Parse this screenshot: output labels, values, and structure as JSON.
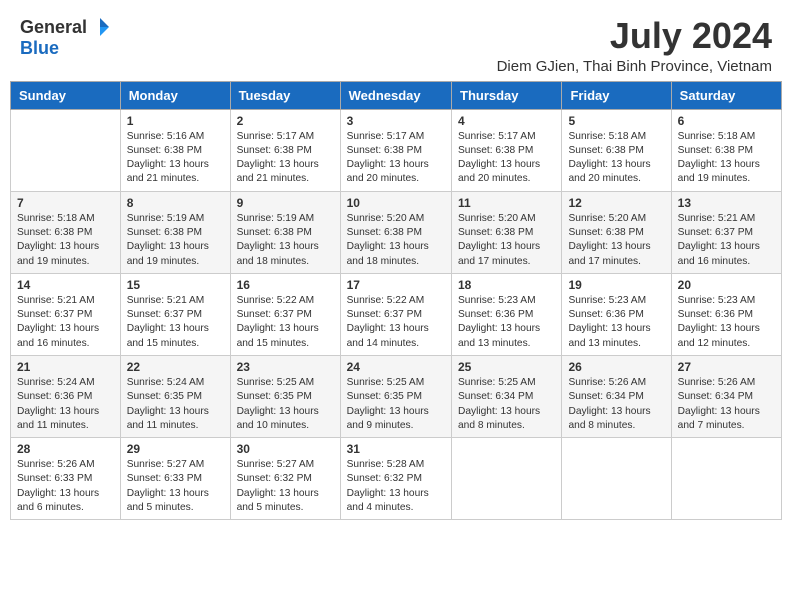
{
  "header": {
    "logo": {
      "general": "General",
      "blue": "Blue"
    },
    "title": "July 2024",
    "location": "Diem GJien, Thai Binh Province, Vietnam"
  },
  "days_of_week": [
    "Sunday",
    "Monday",
    "Tuesday",
    "Wednesday",
    "Thursday",
    "Friday",
    "Saturday"
  ],
  "weeks": [
    [
      {
        "day": "",
        "sunrise": "",
        "sunset": "",
        "daylight": ""
      },
      {
        "day": "1",
        "sunrise": "Sunrise: 5:16 AM",
        "sunset": "Sunset: 6:38 PM",
        "daylight": "Daylight: 13 hours and 21 minutes."
      },
      {
        "day": "2",
        "sunrise": "Sunrise: 5:17 AM",
        "sunset": "Sunset: 6:38 PM",
        "daylight": "Daylight: 13 hours and 21 minutes."
      },
      {
        "day": "3",
        "sunrise": "Sunrise: 5:17 AM",
        "sunset": "Sunset: 6:38 PM",
        "daylight": "Daylight: 13 hours and 20 minutes."
      },
      {
        "day": "4",
        "sunrise": "Sunrise: 5:17 AM",
        "sunset": "Sunset: 6:38 PM",
        "daylight": "Daylight: 13 hours and 20 minutes."
      },
      {
        "day": "5",
        "sunrise": "Sunrise: 5:18 AM",
        "sunset": "Sunset: 6:38 PM",
        "daylight": "Daylight: 13 hours and 20 minutes."
      },
      {
        "day": "6",
        "sunrise": "Sunrise: 5:18 AM",
        "sunset": "Sunset: 6:38 PM",
        "daylight": "Daylight: 13 hours and 19 minutes."
      }
    ],
    [
      {
        "day": "7",
        "sunrise": "Sunrise: 5:18 AM",
        "sunset": "Sunset: 6:38 PM",
        "daylight": "Daylight: 13 hours and 19 minutes."
      },
      {
        "day": "8",
        "sunrise": "Sunrise: 5:19 AM",
        "sunset": "Sunset: 6:38 PM",
        "daylight": "Daylight: 13 hours and 19 minutes."
      },
      {
        "day": "9",
        "sunrise": "Sunrise: 5:19 AM",
        "sunset": "Sunset: 6:38 PM",
        "daylight": "Daylight: 13 hours and 18 minutes."
      },
      {
        "day": "10",
        "sunrise": "Sunrise: 5:20 AM",
        "sunset": "Sunset: 6:38 PM",
        "daylight": "Daylight: 13 hours and 18 minutes."
      },
      {
        "day": "11",
        "sunrise": "Sunrise: 5:20 AM",
        "sunset": "Sunset: 6:38 PM",
        "daylight": "Daylight: 13 hours and 17 minutes."
      },
      {
        "day": "12",
        "sunrise": "Sunrise: 5:20 AM",
        "sunset": "Sunset: 6:38 PM",
        "daylight": "Daylight: 13 hours and 17 minutes."
      },
      {
        "day": "13",
        "sunrise": "Sunrise: 5:21 AM",
        "sunset": "Sunset: 6:37 PM",
        "daylight": "Daylight: 13 hours and 16 minutes."
      }
    ],
    [
      {
        "day": "14",
        "sunrise": "Sunrise: 5:21 AM",
        "sunset": "Sunset: 6:37 PM",
        "daylight": "Daylight: 13 hours and 16 minutes."
      },
      {
        "day": "15",
        "sunrise": "Sunrise: 5:21 AM",
        "sunset": "Sunset: 6:37 PM",
        "daylight": "Daylight: 13 hours and 15 minutes."
      },
      {
        "day": "16",
        "sunrise": "Sunrise: 5:22 AM",
        "sunset": "Sunset: 6:37 PM",
        "daylight": "Daylight: 13 hours and 15 minutes."
      },
      {
        "day": "17",
        "sunrise": "Sunrise: 5:22 AM",
        "sunset": "Sunset: 6:37 PM",
        "daylight": "Daylight: 13 hours and 14 minutes."
      },
      {
        "day": "18",
        "sunrise": "Sunrise: 5:23 AM",
        "sunset": "Sunset: 6:36 PM",
        "daylight": "Daylight: 13 hours and 13 minutes."
      },
      {
        "day": "19",
        "sunrise": "Sunrise: 5:23 AM",
        "sunset": "Sunset: 6:36 PM",
        "daylight": "Daylight: 13 hours and 13 minutes."
      },
      {
        "day": "20",
        "sunrise": "Sunrise: 5:23 AM",
        "sunset": "Sunset: 6:36 PM",
        "daylight": "Daylight: 13 hours and 12 minutes."
      }
    ],
    [
      {
        "day": "21",
        "sunrise": "Sunrise: 5:24 AM",
        "sunset": "Sunset: 6:36 PM",
        "daylight": "Daylight: 13 hours and 11 minutes."
      },
      {
        "day": "22",
        "sunrise": "Sunrise: 5:24 AM",
        "sunset": "Sunset: 6:35 PM",
        "daylight": "Daylight: 13 hours and 11 minutes."
      },
      {
        "day": "23",
        "sunrise": "Sunrise: 5:25 AM",
        "sunset": "Sunset: 6:35 PM",
        "daylight": "Daylight: 13 hours and 10 minutes."
      },
      {
        "day": "24",
        "sunrise": "Sunrise: 5:25 AM",
        "sunset": "Sunset: 6:35 PM",
        "daylight": "Daylight: 13 hours and 9 minutes."
      },
      {
        "day": "25",
        "sunrise": "Sunrise: 5:25 AM",
        "sunset": "Sunset: 6:34 PM",
        "daylight": "Daylight: 13 hours and 8 minutes."
      },
      {
        "day": "26",
        "sunrise": "Sunrise: 5:26 AM",
        "sunset": "Sunset: 6:34 PM",
        "daylight": "Daylight: 13 hours and 8 minutes."
      },
      {
        "day": "27",
        "sunrise": "Sunrise: 5:26 AM",
        "sunset": "Sunset: 6:34 PM",
        "daylight": "Daylight: 13 hours and 7 minutes."
      }
    ],
    [
      {
        "day": "28",
        "sunrise": "Sunrise: 5:26 AM",
        "sunset": "Sunset: 6:33 PM",
        "daylight": "Daylight: 13 hours and 6 minutes."
      },
      {
        "day": "29",
        "sunrise": "Sunrise: 5:27 AM",
        "sunset": "Sunset: 6:33 PM",
        "daylight": "Daylight: 13 hours and 5 minutes."
      },
      {
        "day": "30",
        "sunrise": "Sunrise: 5:27 AM",
        "sunset": "Sunset: 6:32 PM",
        "daylight": "Daylight: 13 hours and 5 minutes."
      },
      {
        "day": "31",
        "sunrise": "Sunrise: 5:28 AM",
        "sunset": "Sunset: 6:32 PM",
        "daylight": "Daylight: 13 hours and 4 minutes."
      },
      {
        "day": "",
        "sunrise": "",
        "sunset": "",
        "daylight": ""
      },
      {
        "day": "",
        "sunrise": "",
        "sunset": "",
        "daylight": ""
      },
      {
        "day": "",
        "sunrise": "",
        "sunset": "",
        "daylight": ""
      }
    ]
  ]
}
